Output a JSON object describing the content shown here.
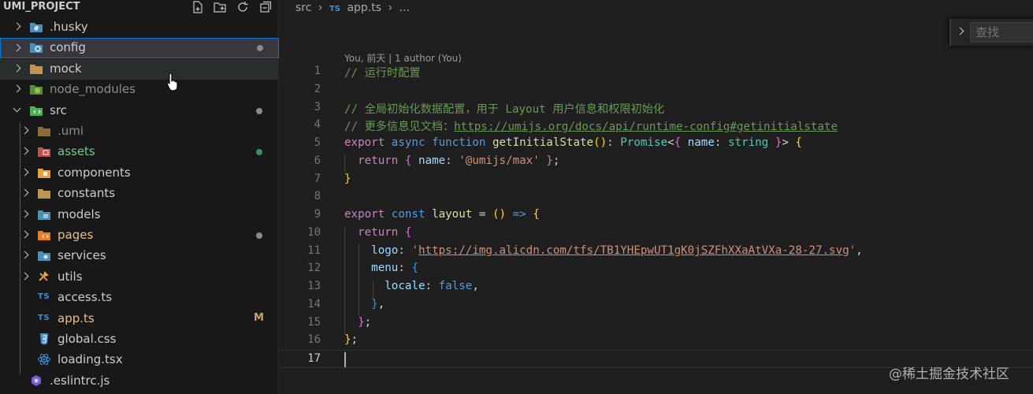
{
  "sidebar": {
    "title": "UMI_PROJECT",
    "actions": [
      "new-file-icon",
      "new-folder-icon",
      "refresh-icon",
      "collapse-all-icon"
    ],
    "items": [
      {
        "label": ".husky",
        "type": "folder",
        "expanded": false,
        "icon": "husky-folder-icon",
        "color": "#cccccc"
      },
      {
        "label": "config",
        "type": "folder",
        "expanded": false,
        "icon": "config-folder-icon",
        "color": "#cccccc",
        "badge": "dot"
      },
      {
        "label": "mock",
        "type": "folder",
        "expanded": false,
        "icon": "folder-icon",
        "color": "#cccccc"
      },
      {
        "label": "node_modules",
        "type": "folder",
        "expanded": false,
        "icon": "node-folder-icon",
        "color": "#8c8c8c"
      },
      {
        "label": "src",
        "type": "folder",
        "expanded": true,
        "icon": "src-folder-icon",
        "color": "#cccccc",
        "badge": "dot"
      },
      {
        "label": ".umi",
        "type": "folder",
        "expanded": false,
        "icon": "folder-icon",
        "color": "#8c8c8c"
      },
      {
        "label": "assets",
        "type": "folder",
        "expanded": false,
        "icon": "assets-folder-icon",
        "color": "#73c991",
        "badge": "dot-green"
      },
      {
        "label": "components",
        "type": "folder",
        "expanded": false,
        "icon": "components-folder-icon",
        "color": "#cccccc"
      },
      {
        "label": "constants",
        "type": "folder",
        "expanded": false,
        "icon": "folder-icon",
        "color": "#cccccc"
      },
      {
        "label": "models",
        "type": "folder",
        "expanded": false,
        "icon": "models-folder-icon",
        "color": "#cccccc"
      },
      {
        "label": "pages",
        "type": "folder",
        "expanded": false,
        "icon": "pages-folder-icon",
        "color": "#e2c08d",
        "badge": "dot"
      },
      {
        "label": "services",
        "type": "folder",
        "expanded": false,
        "icon": "services-folder-icon",
        "color": "#cccccc"
      },
      {
        "label": "utils",
        "type": "folder",
        "expanded": false,
        "icon": "utils-folder-icon",
        "color": "#cccccc"
      },
      {
        "label": "access.ts",
        "type": "file",
        "icon": "typescript-icon",
        "color": "#cccccc"
      },
      {
        "label": "app.ts",
        "type": "file",
        "icon": "typescript-icon",
        "color": "#e2c08d",
        "badge": "M"
      },
      {
        "label": "global.css",
        "type": "file",
        "icon": "css-icon",
        "color": "#cccccc"
      },
      {
        "label": "loading.tsx",
        "type": "file",
        "icon": "react-icon",
        "color": "#cccccc"
      },
      {
        "label": ".eslintrc.js",
        "type": "file",
        "icon": "eslint-icon",
        "color": "#cccccc"
      }
    ]
  },
  "breadcrumb": {
    "items": [
      "src",
      "app.ts",
      "..."
    ],
    "ts_badge": "TS"
  },
  "blame": "You, 前天 | 1 author (You)",
  "find": {
    "placeholder": "查找"
  },
  "editor": {
    "line_numbers": [
      "1",
      "2",
      "3",
      "4",
      "5",
      "6",
      "7",
      "8",
      "9",
      "10",
      "11",
      "12",
      "13",
      "14",
      "15",
      "16",
      "17"
    ],
    "active_line": "17",
    "lines": [
      [
        [
          "c-com",
          "// 运行时配置"
        ]
      ],
      [],
      [
        [
          "c-com",
          "// 全局初始化数据配置，用于 Layout 用户信息和权限初始化"
        ]
      ],
      [
        [
          "c-com",
          "// 更多信息见文档："
        ],
        [
          "c-link",
          "https://umijs.org/docs/api/runtime-config#getinitialstate"
        ]
      ],
      [
        [
          "c-kw2",
          "export"
        ],
        [
          "c-plain",
          " "
        ],
        [
          "c-kw",
          "async"
        ],
        [
          "c-plain",
          " "
        ],
        [
          "c-kw",
          "function"
        ],
        [
          "c-plain",
          " "
        ],
        [
          "c-fn",
          "getInitialState"
        ],
        [
          "c-b1",
          "()"
        ],
        [
          "c-plain",
          ": "
        ],
        [
          "c-type",
          "Promise"
        ],
        [
          "c-plain",
          "<"
        ],
        [
          "c-b2",
          "{"
        ],
        [
          "c-plain",
          " "
        ],
        [
          "c-var",
          "name"
        ],
        [
          "c-plain",
          ": "
        ],
        [
          "c-type",
          "string"
        ],
        [
          "c-plain",
          " "
        ],
        [
          "c-b2",
          "}"
        ],
        [
          "c-plain",
          "> "
        ],
        [
          "c-b1",
          "{"
        ]
      ],
      [
        [
          "c-plain",
          "  "
        ],
        [
          "c-kw2",
          "return"
        ],
        [
          "c-plain",
          " "
        ],
        [
          "c-b2",
          "{"
        ],
        [
          "c-plain",
          " "
        ],
        [
          "c-var",
          "name"
        ],
        [
          "c-plain",
          ": "
        ],
        [
          "c-str",
          "'@umijs/max'"
        ],
        [
          "c-plain",
          " "
        ],
        [
          "c-b2",
          "}"
        ],
        [
          "c-plain",
          ";"
        ]
      ],
      [
        [
          "c-b1",
          "}"
        ]
      ],
      [],
      [
        [
          "c-kw2",
          "export"
        ],
        [
          "c-plain",
          " "
        ],
        [
          "c-kw",
          "const"
        ],
        [
          "c-plain",
          " "
        ],
        [
          "c-fn",
          "layout"
        ],
        [
          "c-plain",
          " = "
        ],
        [
          "c-b1",
          "()"
        ],
        [
          "c-plain",
          " "
        ],
        [
          "c-kw",
          "=>"
        ],
        [
          "c-plain",
          " "
        ],
        [
          "c-b1",
          "{"
        ]
      ],
      [
        [
          "c-plain",
          "  "
        ],
        [
          "c-kw2",
          "return"
        ],
        [
          "c-plain",
          " "
        ],
        [
          "c-b2",
          "{"
        ]
      ],
      [
        [
          "c-plain",
          "    "
        ],
        [
          "c-var",
          "logo"
        ],
        [
          "c-plain",
          ": "
        ],
        [
          "c-str",
          "'"
        ],
        [
          "c-str-link",
          "https://img.alicdn.com/tfs/TB1YHEpwUT1gK0jSZFhXXaAtVXa-28-27.svg"
        ],
        [
          "c-str",
          "'"
        ],
        [
          "c-plain",
          ","
        ]
      ],
      [
        [
          "c-plain",
          "    "
        ],
        [
          "c-var",
          "menu"
        ],
        [
          "c-plain",
          ": "
        ],
        [
          "c-b3",
          "{"
        ]
      ],
      [
        [
          "c-plain",
          "      "
        ],
        [
          "c-var",
          "locale"
        ],
        [
          "c-plain",
          ": "
        ],
        [
          "c-kw",
          "false"
        ],
        [
          "c-plain",
          ","
        ]
      ],
      [
        [
          "c-plain",
          "    "
        ],
        [
          "c-b3",
          "}"
        ],
        [
          "c-plain",
          ","
        ]
      ],
      [
        [
          "c-plain",
          "  "
        ],
        [
          "c-b2",
          "}"
        ],
        [
          "c-plain",
          ";"
        ]
      ],
      [
        [
          "c-b1",
          "}"
        ],
        [
          "c-plain",
          ";"
        ]
      ],
      []
    ]
  },
  "watermark": "@稀土掘金技术社区",
  "colors": {
    "accent": "#0078d4",
    "modified": "#e2c08d",
    "added": "#73c991"
  }
}
